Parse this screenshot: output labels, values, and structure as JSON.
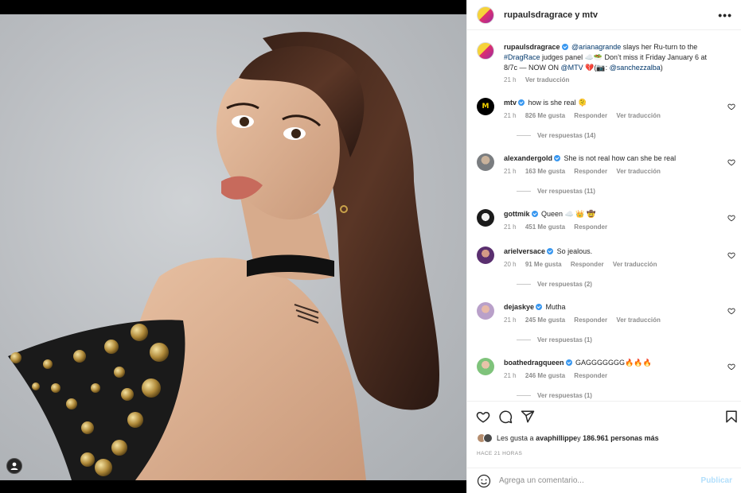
{
  "header": {
    "account_line": "rupaulsdragrace y mtv",
    "more_label": "•••"
  },
  "caption": {
    "user": "rupaulsdragrace",
    "mention_1": "@arianagrande",
    "text_1": " slays her Ru-turn to the ",
    "hashtag": "#DragRace",
    "text_2": " judges panel ☁️🥗 Don’t miss it Friday January 6 at 8/7c — NOW ON ",
    "mention_2": "@MTV",
    "text_3": " 💔(📷: ",
    "mention_3": "@sanchezzalba",
    "text_4": ")",
    "time": "21 h",
    "translate": "Ver traducción"
  },
  "comments": [
    {
      "user": "mtv",
      "text": "how is she real 🫠",
      "time": "21 h",
      "likes": "826 Me gusta",
      "reply": "Responder",
      "translate": "Ver traducción",
      "replies": "Ver respuestas (14)"
    },
    {
      "user": "alexandergold",
      "text": "She is not real how can she be real",
      "time": "21 h",
      "likes": "163 Me gusta",
      "reply": "Responder",
      "translate": "Ver traducción",
      "replies": "Ver respuestas (11)"
    },
    {
      "user": "gottmik",
      "text": "Queen ☁️ 👑 🤠",
      "time": "21 h",
      "likes": "451 Me gusta",
      "reply": "Responder"
    },
    {
      "user": "arielversace",
      "text": "So jealous.",
      "time": "20 h",
      "likes": "91 Me gusta",
      "reply": "Responder",
      "translate": "Ver traducción",
      "replies": "Ver respuestas (2)"
    },
    {
      "user": "dejaskye",
      "text": "Mutha",
      "time": "21 h",
      "likes": "245 Me gusta",
      "reply": "Responder",
      "translate": "Ver traducción",
      "replies": "Ver respuestas (1)"
    },
    {
      "user": "boathedragqueen",
      "text": "GAGGGGGGG🔥🔥🔥",
      "time": "21 h",
      "likes": "246 Me gusta",
      "reply": "Responder",
      "replies": "Ver respuestas (1)"
    }
  ],
  "likes_line": {
    "prefix": "Les gusta a ",
    "user": "avaphillippe",
    "middle": " y ",
    "count": "186.961 personas más"
  },
  "posted_ago": "HACE 21 HORAS",
  "add_comment": {
    "placeholder": "Agrega un comentario...",
    "post_label": "Publicar"
  },
  "avatar_mtv_text": "M",
  "colors": {
    "verified_blue": "#3897f0",
    "link": "#00376b",
    "muted": "#8e8e8e",
    "post_disabled": "#b2dffc"
  },
  "icons": [
    "heart-icon",
    "comment-icon",
    "share-icon",
    "bookmark-icon",
    "emoji-icon",
    "user-tag-icon",
    "more-icon"
  ]
}
